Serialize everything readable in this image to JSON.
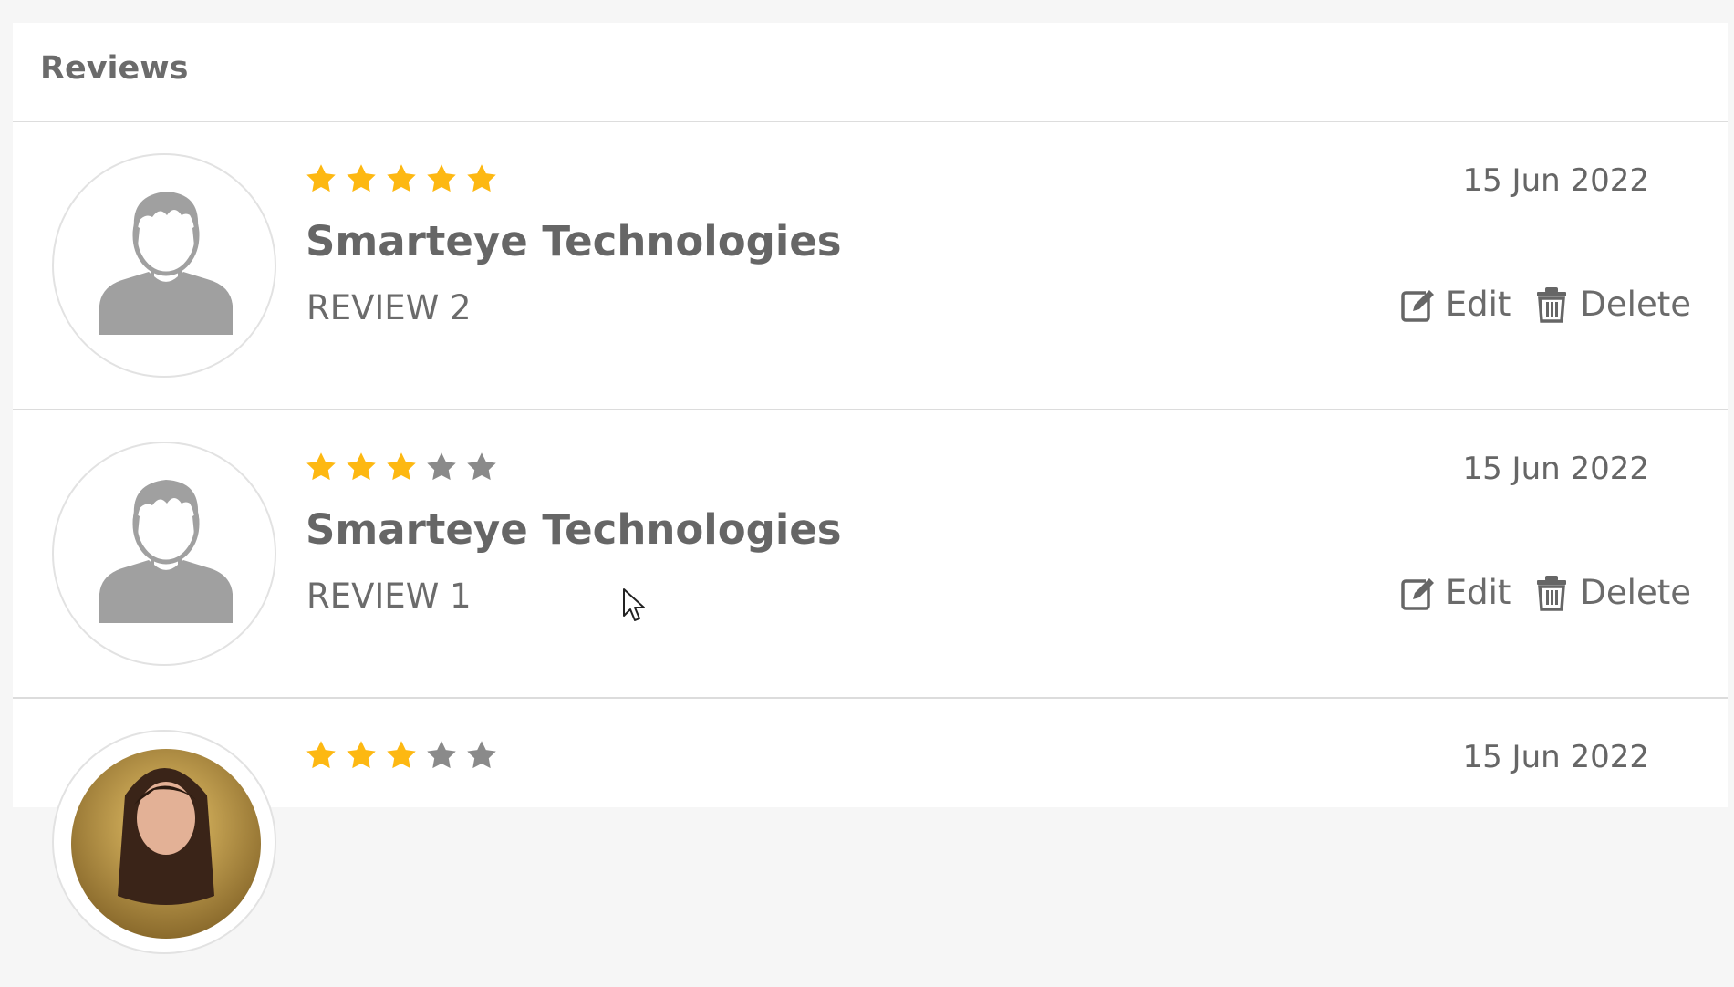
{
  "panel": {
    "title": "Reviews"
  },
  "colors": {
    "star_filled": "#fdb812",
    "star_empty": "#8a8a8a",
    "text": "#666666"
  },
  "reviews": [
    {
      "rating": 5,
      "name": "Smarteye Technologies",
      "text": "REVIEW 2",
      "date": "15 Jun 2022",
      "avatar": "default-user-icon",
      "edit_label": "Edit",
      "delete_label": "Delete"
    },
    {
      "rating": 3,
      "name": "Smarteye Technologies",
      "text": "REVIEW 1",
      "date": "15 Jun 2022",
      "avatar": "default-user-icon",
      "edit_label": "Edit",
      "delete_label": "Delete"
    },
    {
      "rating": 3,
      "name": "",
      "text": "",
      "date": "15 Jun 2022",
      "avatar": "user-photo",
      "edit_label": "",
      "delete_label": ""
    }
  ]
}
